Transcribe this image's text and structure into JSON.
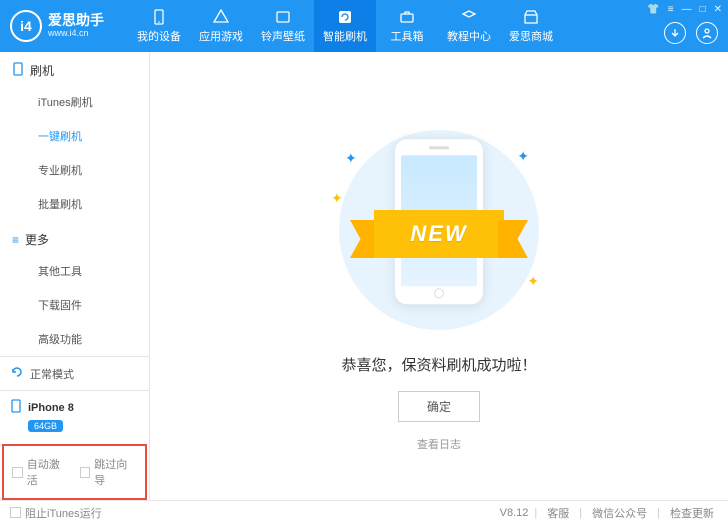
{
  "logo": {
    "badge": "i4",
    "title": "爱思助手",
    "sub": "www.i4.cn"
  },
  "nav": [
    {
      "label": "我的设备",
      "icon": "device"
    },
    {
      "label": "应用游戏",
      "icon": "apps"
    },
    {
      "label": "铃声壁纸",
      "icon": "ringtone"
    },
    {
      "label": "智能刷机",
      "icon": "flash",
      "active": true
    },
    {
      "label": "工具箱",
      "icon": "tools"
    },
    {
      "label": "教程中心",
      "icon": "tutorial"
    },
    {
      "label": "爱思商城",
      "icon": "store"
    }
  ],
  "sidebar": {
    "section1": {
      "title": "刷机",
      "items": [
        "iTunes刷机",
        "一键刷机",
        "专业刷机",
        "批量刷机"
      ],
      "active_index": 1
    },
    "section2": {
      "title": "更多",
      "items": [
        "其他工具",
        "下载固件",
        "高级功能"
      ]
    }
  },
  "status": {
    "mode": "正常模式"
  },
  "device": {
    "name": "iPhone 8",
    "storage": "64GB"
  },
  "bottom_checks": {
    "auto_activate": "自动激活",
    "skip_guide": "跳过向导"
  },
  "content": {
    "ribbon": "NEW",
    "message": "恭喜您，保资料刷机成功啦！",
    "confirm": "确定",
    "log": "查看日志"
  },
  "footer": {
    "block_itunes": "阻止iTunes运行",
    "version": "V8.12",
    "service": "客服",
    "wechat": "微信公众号",
    "update": "检查更新"
  }
}
